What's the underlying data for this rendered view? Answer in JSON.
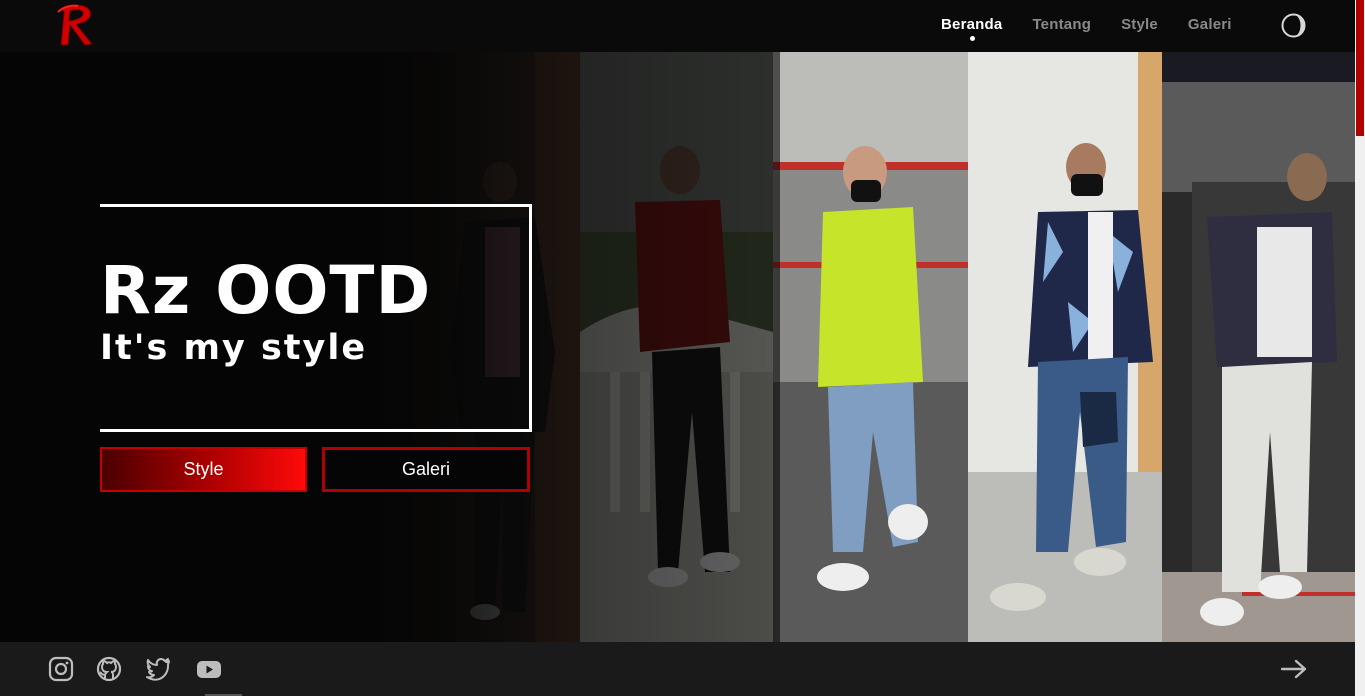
{
  "brand": {
    "logo_letter": "R",
    "logo_color": "#d10000"
  },
  "nav": {
    "items": [
      {
        "label": "Beranda",
        "active": true
      },
      {
        "label": "Tentang",
        "active": false
      },
      {
        "label": "Style",
        "active": false
      },
      {
        "label": "Galeri",
        "active": false
      }
    ],
    "theme_toggle_icon": "half-moon-icon"
  },
  "hero": {
    "title": "Rz OOTD",
    "subtitle": "It's my style",
    "buttons": {
      "style_label": "Style",
      "galeri_label": "Galeri"
    }
  },
  "footer": {
    "social_icons": [
      "instagram-icon",
      "github-icon",
      "twitter-icon",
      "youtube-icon"
    ],
    "next_icon": "arrow-right-icon"
  },
  "colors": {
    "accent": "#d10000",
    "nav_bg": "#0a0a0a",
    "footer_bg": "#1a1a1a",
    "nav_inactive": "#8a8a8a"
  }
}
